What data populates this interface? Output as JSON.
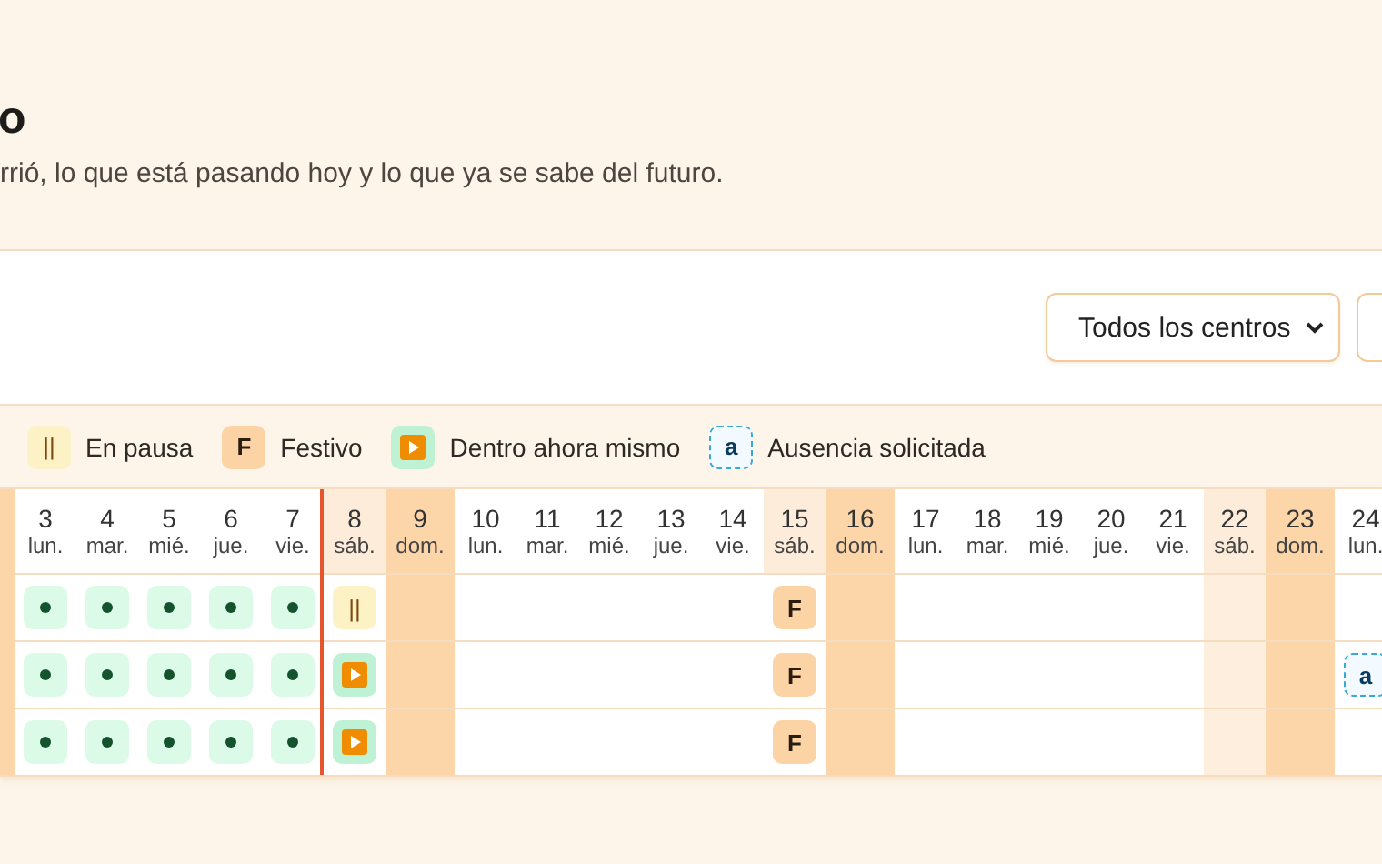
{
  "header": {
    "title": "o",
    "subtitle": "rrió, lo que está pasando hoy y lo que ya se sabe del futuro."
  },
  "filters": {
    "center_select": "Todos los centros"
  },
  "legend": [
    {
      "kind": "paused",
      "symbol": "||",
      "label": "En pausa"
    },
    {
      "kind": "holiday",
      "symbol": "F",
      "label": "Festivo"
    },
    {
      "kind": "inside",
      "label": "Dentro ahora mismo"
    },
    {
      "kind": "absence",
      "symbol": "a",
      "label": "Ausencia solicitada"
    }
  ],
  "days": [
    {
      "number": "3",
      "weekday": "lun.",
      "kind": "weekday",
      "today": false,
      "tinted": false
    },
    {
      "number": "4",
      "weekday": "mar.",
      "kind": "weekday",
      "today": false,
      "tinted": false
    },
    {
      "number": "5",
      "weekday": "mié.",
      "kind": "weekday",
      "today": false,
      "tinted": false
    },
    {
      "number": "6",
      "weekday": "jue.",
      "kind": "weekday",
      "today": false,
      "tinted": false
    },
    {
      "number": "7",
      "weekday": "vie.",
      "kind": "weekday",
      "today": false,
      "tinted": false
    },
    {
      "number": "8",
      "weekday": "sáb.",
      "kind": "saturday",
      "today": true,
      "tinted": false
    },
    {
      "number": "9",
      "weekday": "dom.",
      "kind": "sunday",
      "today": false,
      "tinted": false
    },
    {
      "number": "10",
      "weekday": "lun.",
      "kind": "weekday",
      "today": false,
      "tinted": false
    },
    {
      "number": "11",
      "weekday": "mar.",
      "kind": "weekday",
      "today": false,
      "tinted": false
    },
    {
      "number": "12",
      "weekday": "mié.",
      "kind": "weekday",
      "today": false,
      "tinted": false
    },
    {
      "number": "13",
      "weekday": "jue.",
      "kind": "weekday",
      "today": false,
      "tinted": false
    },
    {
      "number": "14",
      "weekday": "vie.",
      "kind": "weekday",
      "today": false,
      "tinted": false
    },
    {
      "number": "15",
      "weekday": "sáb.",
      "kind": "saturday",
      "today": false,
      "tinted": false
    },
    {
      "number": "16",
      "weekday": "dom.",
      "kind": "sunday",
      "today": false,
      "tinted": false
    },
    {
      "number": "17",
      "weekday": "lun.",
      "kind": "weekday",
      "today": false,
      "tinted": false
    },
    {
      "number": "18",
      "weekday": "mar.",
      "kind": "weekday",
      "today": false,
      "tinted": false
    },
    {
      "number": "19",
      "weekday": "mié.",
      "kind": "weekday",
      "today": false,
      "tinted": false
    },
    {
      "number": "20",
      "weekday": "jue.",
      "kind": "weekday",
      "today": false,
      "tinted": false
    },
    {
      "number": "21",
      "weekday": "vie.",
      "kind": "weekday",
      "today": false,
      "tinted": false
    },
    {
      "number": "22",
      "weekday": "sáb.",
      "kind": "saturday",
      "today": false,
      "tinted": true
    },
    {
      "number": "23",
      "weekday": "dom.",
      "kind": "sunday",
      "today": false,
      "tinted": false
    },
    {
      "number": "24",
      "weekday": "lun.",
      "kind": "weekday",
      "today": false,
      "tinted": false
    }
  ],
  "rows": [
    {
      "cells": [
        {
          "kind": "worked"
        },
        {
          "kind": "worked"
        },
        {
          "kind": "worked"
        },
        {
          "kind": "worked"
        },
        {
          "kind": "worked"
        },
        {
          "kind": "paused",
          "symbol": "||"
        },
        {
          "kind": "empty"
        },
        {
          "kind": "empty"
        },
        {
          "kind": "empty"
        },
        {
          "kind": "empty"
        },
        {
          "kind": "empty"
        },
        {
          "kind": "empty"
        },
        {
          "kind": "holiday",
          "symbol": "F"
        },
        {
          "kind": "empty"
        },
        {
          "kind": "empty"
        },
        {
          "kind": "empty"
        },
        {
          "kind": "empty"
        },
        {
          "kind": "empty"
        },
        {
          "kind": "empty"
        },
        {
          "kind": "empty"
        },
        {
          "kind": "empty"
        },
        {
          "kind": "empty"
        }
      ]
    },
    {
      "cells": [
        {
          "kind": "worked"
        },
        {
          "kind": "worked"
        },
        {
          "kind": "worked"
        },
        {
          "kind": "worked"
        },
        {
          "kind": "worked"
        },
        {
          "kind": "inside"
        },
        {
          "kind": "empty"
        },
        {
          "kind": "empty"
        },
        {
          "kind": "empty"
        },
        {
          "kind": "empty"
        },
        {
          "kind": "empty"
        },
        {
          "kind": "empty"
        },
        {
          "kind": "holiday",
          "symbol": "F"
        },
        {
          "kind": "empty"
        },
        {
          "kind": "empty"
        },
        {
          "kind": "empty"
        },
        {
          "kind": "empty"
        },
        {
          "kind": "empty"
        },
        {
          "kind": "empty"
        },
        {
          "kind": "empty"
        },
        {
          "kind": "empty"
        },
        {
          "kind": "absence",
          "symbol": "a"
        }
      ]
    },
    {
      "cells": [
        {
          "kind": "worked"
        },
        {
          "kind": "worked"
        },
        {
          "kind": "worked"
        },
        {
          "kind": "worked"
        },
        {
          "kind": "worked"
        },
        {
          "kind": "inside"
        },
        {
          "kind": "empty"
        },
        {
          "kind": "empty"
        },
        {
          "kind": "empty"
        },
        {
          "kind": "empty"
        },
        {
          "kind": "empty"
        },
        {
          "kind": "empty"
        },
        {
          "kind": "holiday",
          "symbol": "F"
        },
        {
          "kind": "empty"
        },
        {
          "kind": "empty"
        },
        {
          "kind": "empty"
        },
        {
          "kind": "empty"
        },
        {
          "kind": "empty"
        },
        {
          "kind": "empty"
        },
        {
          "kind": "empty"
        },
        {
          "kind": "empty"
        },
        {
          "kind": "empty"
        }
      ]
    }
  ]
}
